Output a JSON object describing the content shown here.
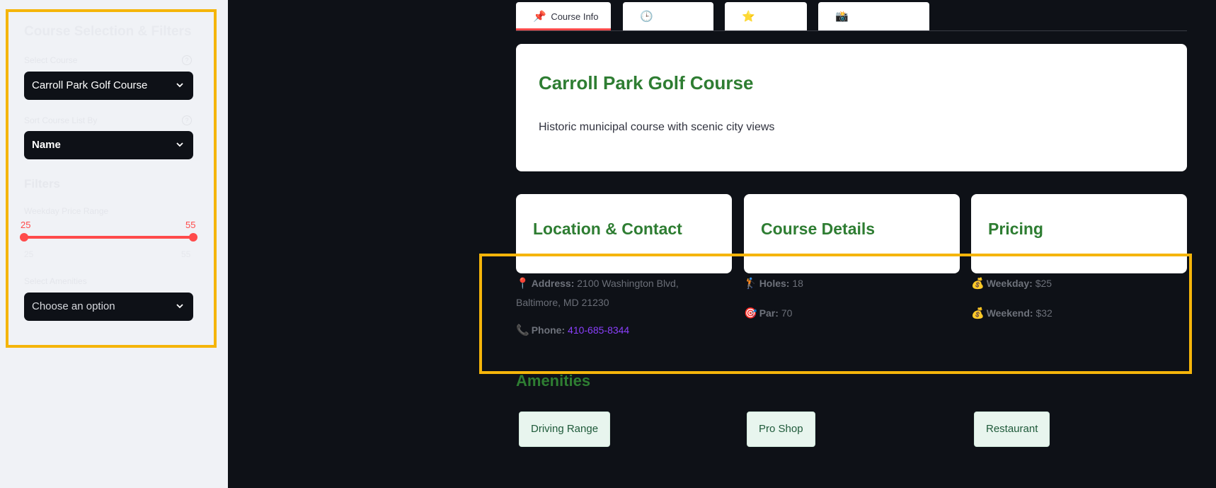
{
  "sidebar": {
    "title": "Course Selection & Filters",
    "select_course_label": "Select Course",
    "select_course_value": "Carroll Park Golf Course",
    "sort_label": "Sort Course List By",
    "sort_value": "Name",
    "filters_title": "Filters",
    "price_label": "Weekday Price Range",
    "price_low": "25",
    "price_high": "55",
    "price_min": "25",
    "price_max": "55",
    "amenities_label": "Select Amenities",
    "amenities_placeholder": "Choose an option",
    "help_icon": "?"
  },
  "tabs": [
    {
      "icon": "📌",
      "label": "Course Info"
    },
    {
      "icon": "🕒",
      "label": ""
    },
    {
      "icon": "⭐",
      "label": ""
    },
    {
      "icon": "📸",
      "label": ""
    }
  ],
  "hero": {
    "title": "Carroll Park Golf Course",
    "description": "Historic municipal course with scenic city views"
  },
  "location": {
    "title": "Location & Contact",
    "address_icon": "📍",
    "address_label": "Address:",
    "address_line1": "2100 Washington Blvd,",
    "address_line2": "Baltimore, MD 21230",
    "phone_icon": "📞",
    "phone_label": "Phone:",
    "phone_value": "410-685-8344"
  },
  "details": {
    "title": "Course Details",
    "holes_icon": "🏌",
    "holes_label": "Holes:",
    "holes_value": "18",
    "par_icon": "🎯",
    "par_label": "Par:",
    "par_value": "70"
  },
  "pricing": {
    "title": "Pricing",
    "weekday_icon": "💰",
    "weekday_label": "Weekday:",
    "weekday_value": "$25",
    "weekend_icon": "💰",
    "weekend_label": "Weekend:",
    "weekend_value": "$32"
  },
  "amenities": {
    "title": "Amenities",
    "items": [
      "Driving Range",
      "Pro Shop",
      "Restaurant"
    ]
  },
  "colors": {
    "accent": "#ff4b4b",
    "heading_green": "#2e7d32",
    "highlight": "#f5b50a",
    "link": "#8a3ffc"
  }
}
